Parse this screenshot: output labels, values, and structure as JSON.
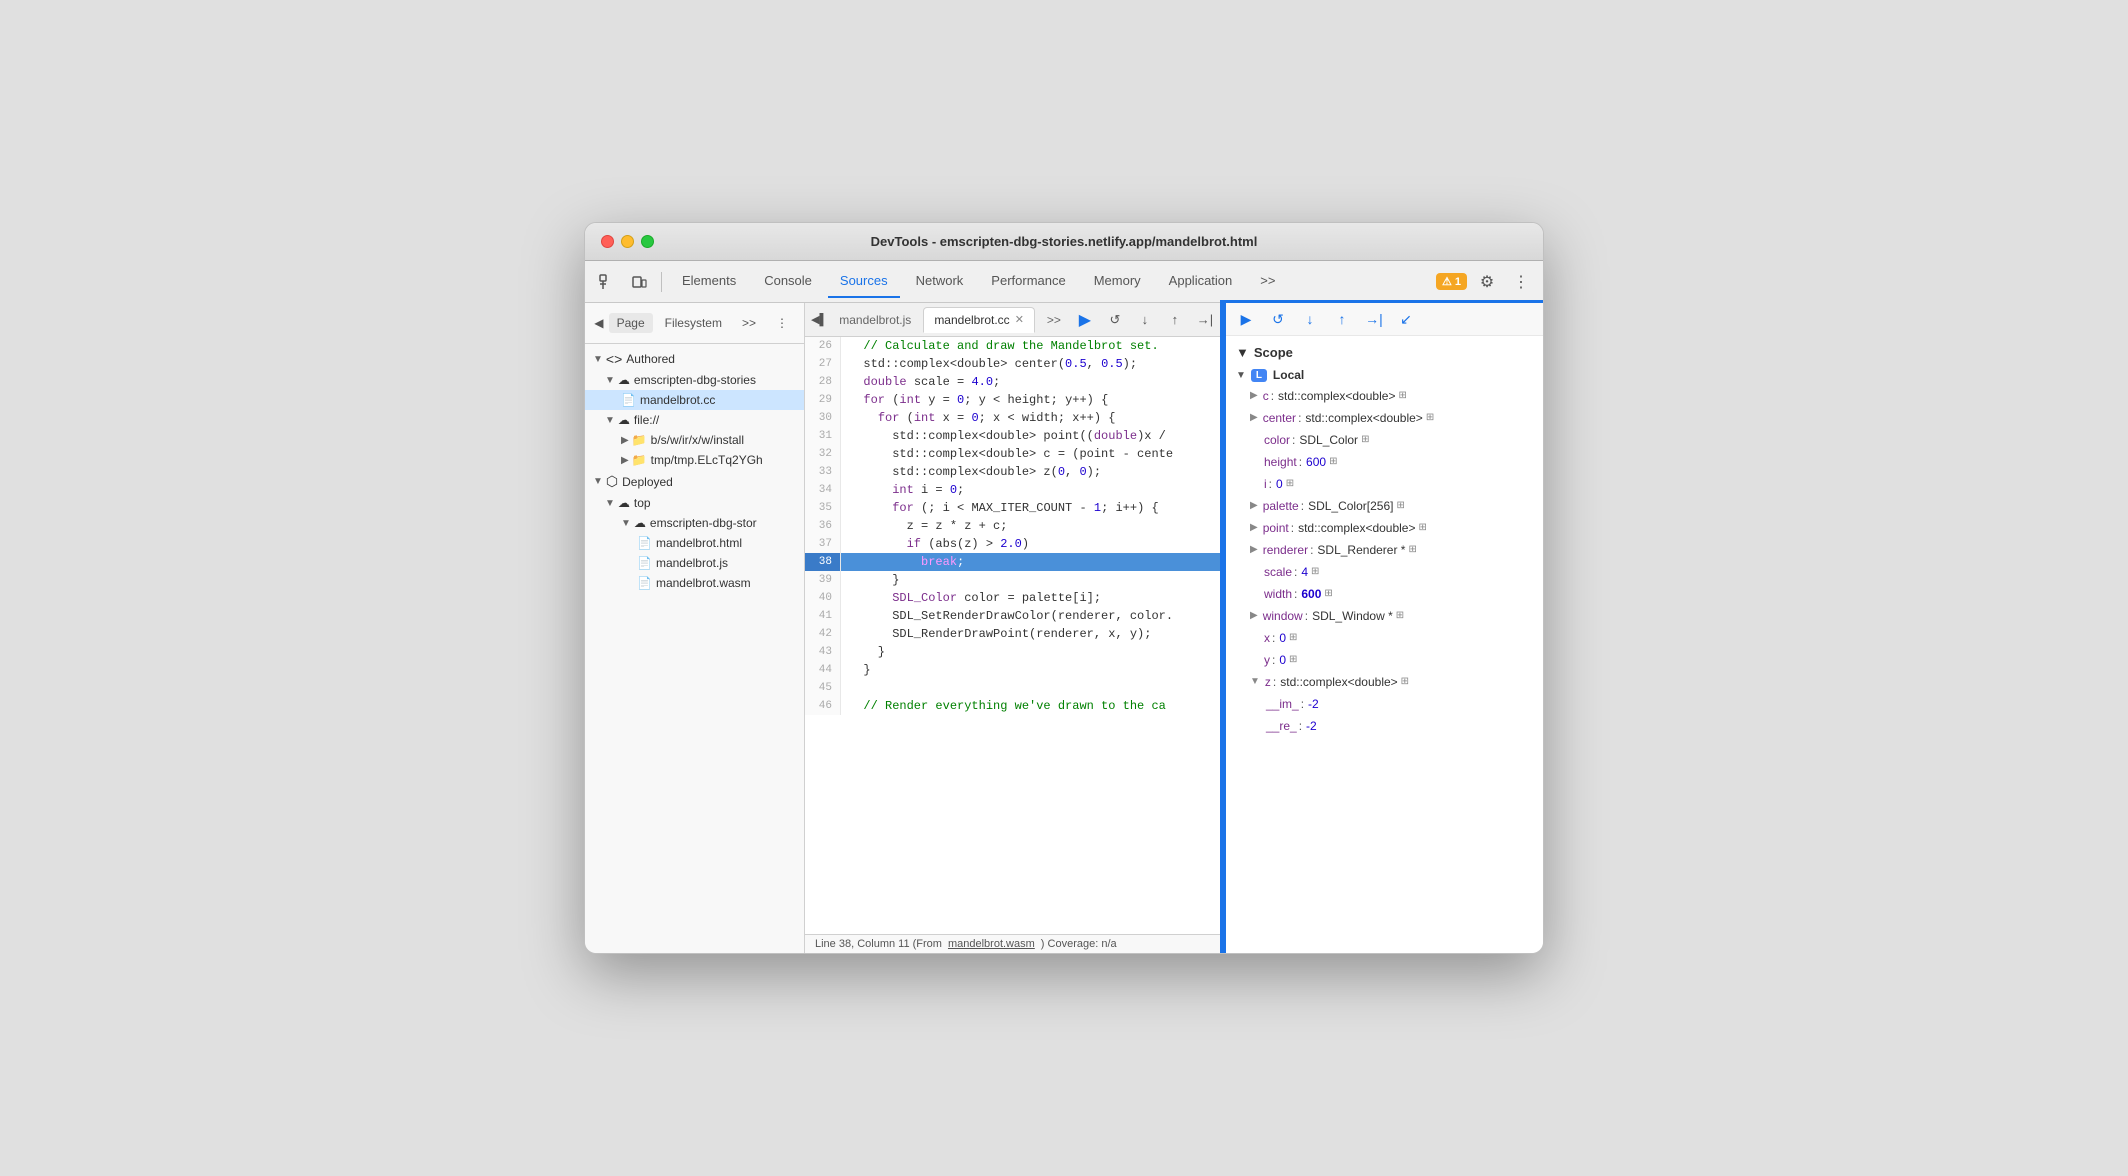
{
  "window": {
    "title": "DevTools - emscripten-dbg-stories.netlify.app/mandelbrot.html"
  },
  "toolbar": {
    "tabs": [
      {
        "label": "Elements",
        "active": false
      },
      {
        "label": "Console",
        "active": false
      },
      {
        "label": "Sources",
        "active": true
      },
      {
        "label": "Network",
        "active": false
      },
      {
        "label": "Performance",
        "active": false
      },
      {
        "label": "Memory",
        "active": false
      },
      {
        "label": "Application",
        "active": false
      }
    ],
    "warning_count": "1",
    "more_label": ">>"
  },
  "sidebar": {
    "tabs": [
      "Page",
      "Filesystem"
    ],
    "more": ">>",
    "tree": {
      "authored_label": "Authored",
      "cloud1_label": "emscripten-dbg-stories",
      "file1_label": "mandelbrot.cc",
      "file_uri_label": "file://",
      "folder1_label": "b/s/w/ir/x/w/install",
      "folder2_label": "tmp/tmp.ELcTq2YGh",
      "deployed_label": "Deployed",
      "cloud2_label": "top",
      "cloud3_label": "emscripten-dbg-stor",
      "file2_label": "mandelbrot.html",
      "file3_label": "mandelbrot.js",
      "file4_label": "mandelbrot.wasm"
    }
  },
  "code_panel": {
    "tabs": [
      {
        "label": "mandelbrot.js",
        "active": false,
        "closable": false
      },
      {
        "label": "mandelbrot.cc",
        "active": true,
        "closable": true
      }
    ],
    "lines": [
      {
        "num": 29,
        "content": "",
        "highlight": false
      },
      {
        "num": 26,
        "content": "  // Calculate and draw the Mandelbrot set.",
        "highlight": false,
        "comment": true
      },
      {
        "num": 27,
        "content": "  std::complex<double> center(0.5, 0.5);",
        "highlight": false
      },
      {
        "num": 28,
        "content": "  double scale = 4.0;",
        "highlight": false
      },
      {
        "num": 29,
        "content": "  for (int y = 0; y < height; y++) {",
        "highlight": false
      },
      {
        "num": 30,
        "content": "    for (int x = 0; x < width; x++) {",
        "highlight": false
      },
      {
        "num": 31,
        "content": "      std::complex<double> point((double)x /",
        "highlight": false
      },
      {
        "num": 32,
        "content": "      std::complex<double> c = (point - cente",
        "highlight": false
      },
      {
        "num": 33,
        "content": "      std::complex<double> z(0, 0);",
        "highlight": false
      },
      {
        "num": 34,
        "content": "      int i = 0;",
        "highlight": false
      },
      {
        "num": 35,
        "content": "      for (; i < MAX_ITER_COUNT - 1; i++) {",
        "highlight": false
      },
      {
        "num": 36,
        "content": "        z = z * z + c;",
        "highlight": false
      },
      {
        "num": 37,
        "content": "        if (abs(z) > 2.0)",
        "highlight": false
      },
      {
        "num": 38,
        "content": "          break;",
        "highlight": true
      },
      {
        "num": 39,
        "content": "      }",
        "highlight": false
      },
      {
        "num": 40,
        "content": "      SDL_Color color = palette[i];",
        "highlight": false
      },
      {
        "num": 41,
        "content": "      SDL_SetRenderDrawColor(renderer, color.",
        "highlight": false
      },
      {
        "num": 42,
        "content": "      SDL_RenderDrawPoint(renderer, x, y);",
        "highlight": false
      },
      {
        "num": 43,
        "content": "    }",
        "highlight": false
      },
      {
        "num": 44,
        "content": "  }",
        "highlight": false
      },
      {
        "num": 45,
        "content": "",
        "highlight": false
      },
      {
        "num": 46,
        "content": "  // Render everything we've drawn to the ca",
        "highlight": false,
        "comment": true
      }
    ],
    "status": {
      "text": "Line 38, Column 11 (From ",
      "link": "mandelbrot.wasm",
      "suffix": ") Coverage: n/a"
    }
  },
  "scope_panel": {
    "title": "Scope",
    "local_label": "Local",
    "variables": [
      {
        "key": "c",
        "sep": ":",
        "val": "std::complex<double>",
        "has_icon": true,
        "expandable": true
      },
      {
        "key": "center",
        "sep": ":",
        "val": "std::complex<double>",
        "has_icon": true,
        "expandable": true
      },
      {
        "key": "color",
        "sep": ":",
        "val": "SDL_Color",
        "has_icon": true,
        "expandable": false
      },
      {
        "key": "height",
        "sep": ":",
        "val": "600",
        "has_icon": true,
        "expandable": false,
        "is_num": true
      },
      {
        "key": "i",
        "sep": ":",
        "val": "0",
        "has_icon": true,
        "expandable": false,
        "is_num": true
      },
      {
        "key": "palette",
        "sep": ":",
        "val": "SDL_Color[256]",
        "has_icon": true,
        "expandable": true
      },
      {
        "key": "point",
        "sep": ":",
        "val": "std::complex<double>",
        "has_icon": true,
        "expandable": true
      },
      {
        "key": "renderer",
        "sep": ":",
        "val": "SDL_Renderer *",
        "has_icon": true,
        "expandable": true
      },
      {
        "key": "scale",
        "sep": ":",
        "val": "4",
        "has_icon": true,
        "expandable": false,
        "is_num": true
      },
      {
        "key": "width",
        "sep": ":",
        "val": "600",
        "has_icon": true,
        "expandable": false,
        "is_num": true,
        "bold_val": true
      },
      {
        "key": "window",
        "sep": ":",
        "val": "SDL_Window *",
        "has_icon": true,
        "expandable": true
      },
      {
        "key": "x",
        "sep": ":",
        "val": "0",
        "has_icon": true,
        "expandable": false,
        "is_num": true
      },
      {
        "key": "y",
        "sep": ":",
        "val": "0",
        "has_icon": true,
        "expandable": false,
        "is_num": true
      },
      {
        "key": "z",
        "sep": ":",
        "val": "std::complex<double>",
        "has_icon": true,
        "expandable": true,
        "expanded": true
      },
      {
        "key": "__im_",
        "sep": ":",
        "val": "-2",
        "indent": true,
        "is_num": true
      },
      {
        "key": "__re_",
        "sep": ":",
        "val": "-2",
        "indent": true,
        "is_num": true
      }
    ]
  }
}
